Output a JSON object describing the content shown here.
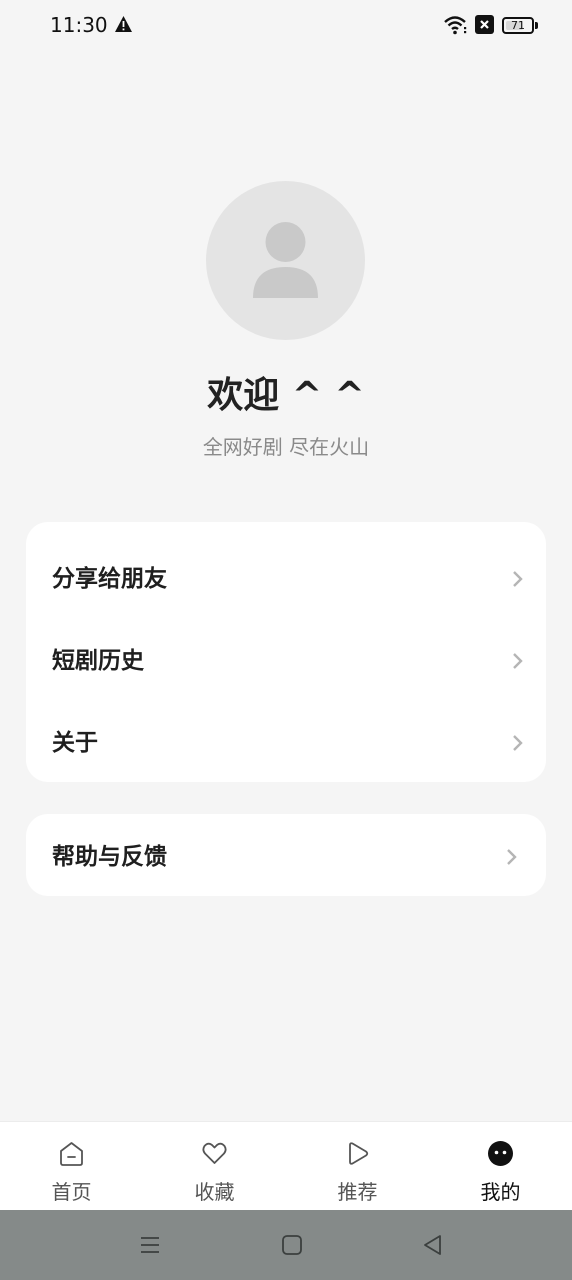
{
  "status": {
    "time": "11:30",
    "battery": "71",
    "battery_level": 0.71,
    "icons": [
      "alert-icon",
      "wifi-icon",
      "sim-error-icon",
      "battery-icon"
    ]
  },
  "profile": {
    "avatar_icon": "user-avatar-icon",
    "welcome": "欢迎 ^ ^",
    "subtitle": "全网好剧 尽在火山"
  },
  "menu": {
    "group1": [
      {
        "label": "分享给朋友"
      },
      {
        "label": "短剧历史"
      },
      {
        "label": "关于"
      }
    ],
    "group2": [
      {
        "label": "帮助与反馈"
      }
    ],
    "chevron_icon": "chevron-right-icon"
  },
  "tabs": [
    {
      "label": "首页",
      "icon": "home-icon",
      "active": false
    },
    {
      "label": "收藏",
      "icon": "heart-icon",
      "active": false
    },
    {
      "label": "推荐",
      "icon": "play-icon",
      "active": false
    },
    {
      "label": "我的",
      "icon": "profile-face-icon",
      "active": true
    }
  ],
  "system_nav": [
    "menu-icon",
    "home-square-icon",
    "back-triangle-icon"
  ],
  "colors": {
    "background": "#f5f5f5",
    "card": "#ffffff",
    "active_tab": "#111111",
    "nav_bar": "#858a89"
  }
}
